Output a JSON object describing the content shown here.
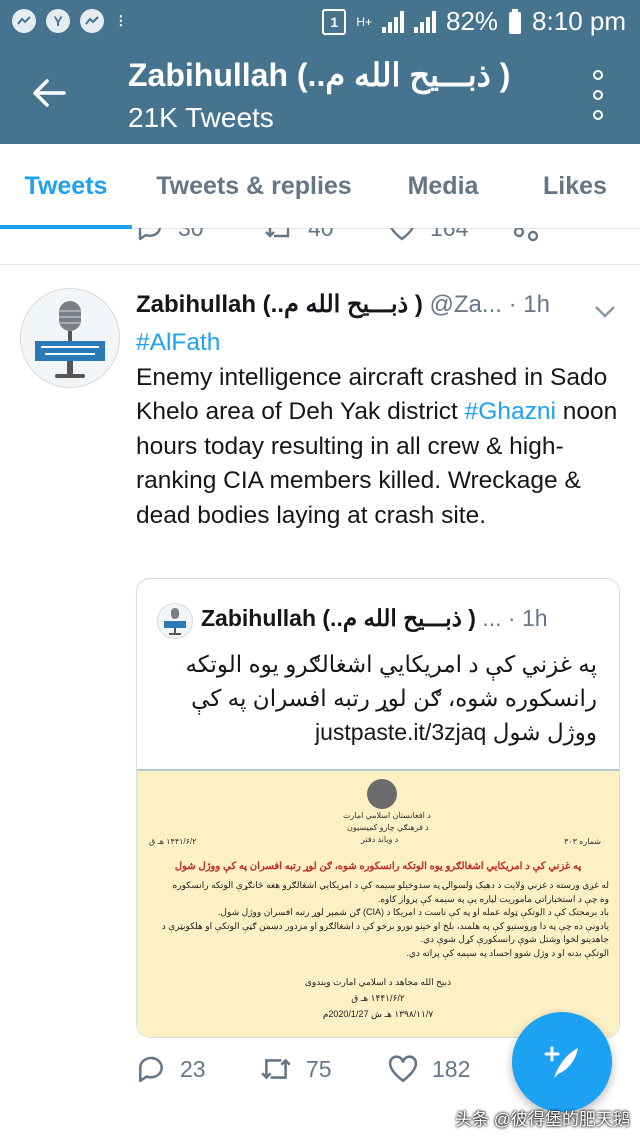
{
  "status_bar": {
    "apps": [
      "messenger-icon",
      "Y",
      "messenger-icon"
    ],
    "more": "⁝",
    "sim_badge": "1",
    "network": "H+",
    "battery": "82%",
    "time": "8:10 pm"
  },
  "header": {
    "title": "Zabihullah (..ذبـــیح الله م )",
    "subtitle": "21K Tweets"
  },
  "tabs": [
    {
      "label": "Tweets",
      "active": true
    },
    {
      "label": "Tweets & replies",
      "active": false
    },
    {
      "label": "Media",
      "active": false
    },
    {
      "label": "Likes",
      "active": false
    }
  ],
  "previous_tweet": {
    "replies": "30",
    "retweets": "40",
    "likes": "164"
  },
  "tweet": {
    "name": "Zabihullah (..ذبـــیح الله م )",
    "handle": "@Za...",
    "time": "· 1h",
    "hashtag": "#AlFath",
    "text_part1": "Enemy intelligence aircraft crashed in Sado Khelo area of Deh Yak district ",
    "hashtag2": "#Ghazni",
    "text_part2": " noon hours today resulting in all crew & high-ranking CIA members killed. Wreckage & dead bodies laying at crash site.",
    "quoted": {
      "name": "Zabihullah (..ذبـــیح الله م )",
      "handle": "...",
      "time": "· 1h",
      "text": "په غزني کې د امریکایي اشغالګرو یوه الوتکه رانسکوره شوه، ګن لوړ رتبه افسران په کې ووژل شول",
      "link": "justpaste.it/3zjaq",
      "document": {
        "header_lines": [
          "د افغانستان اسلامي امارت",
          "د فرهنګي چارو کميسيون",
          "د ویاند دفتر"
        ],
        "number": "شماره ۳۰۳",
        "date": "۱۴۴۱/۶/۲ هـ ق",
        "title": "په غزني کې د امریکایي اشغالګرو یوه الوتکه رانسکوره شوه، ګن لوړ رتبه افسران په کې ووژل شول",
        "lines": [
          "له غږي ورسته د غزني ولایت د دهیک ولسوالۍ په سدوخیلو سیمه کې د امریکایي اشغالګرو هغه څانګړې الوتکه رانسکوره",
          "وه چې د استخباراتي ماموریت لپاره یې په سیمه کې پرواز کاوه.",
          "باد برمحتک کې د الوتکې ټوله عمله او په کې ناست د امریکا د (CIA) ګن شمېر لوړ رتبه افسران ووژل شول.",
          "یادونې ده چې په دا وروستیو کې په هلمند، بلخ او خینو نورو برخو کې د اشغالګرو او مزدور دښمن ګڼې الوتکې او هلکوبټرې د",
          "جاهدینو لخوا وشتل شوې رانسکورې کړل شوې دي.",
          "الوتکې بدنه او د وژل شوو اجساد په سیمه کې پراته دي."
        ],
        "signature": "ذبیح الله مجاهد د اسلامي امارت ویندوی",
        "sign_date1": "۱۴۴۱/۶/۲ هـ ق",
        "sign_date2": "۱۳۹۸/۱۱/۷ هـ ش 2020/1/27م"
      }
    },
    "replies": "23",
    "retweets": "75",
    "likes": "182"
  },
  "watermark": "头条 @彼得堡的肥天鹅",
  "colors": {
    "header_bg": "#46748f",
    "accent": "#1da1f2",
    "muted": "#657786",
    "doc_bg": "#fdf0c4",
    "doc_title": "#c0272d"
  }
}
